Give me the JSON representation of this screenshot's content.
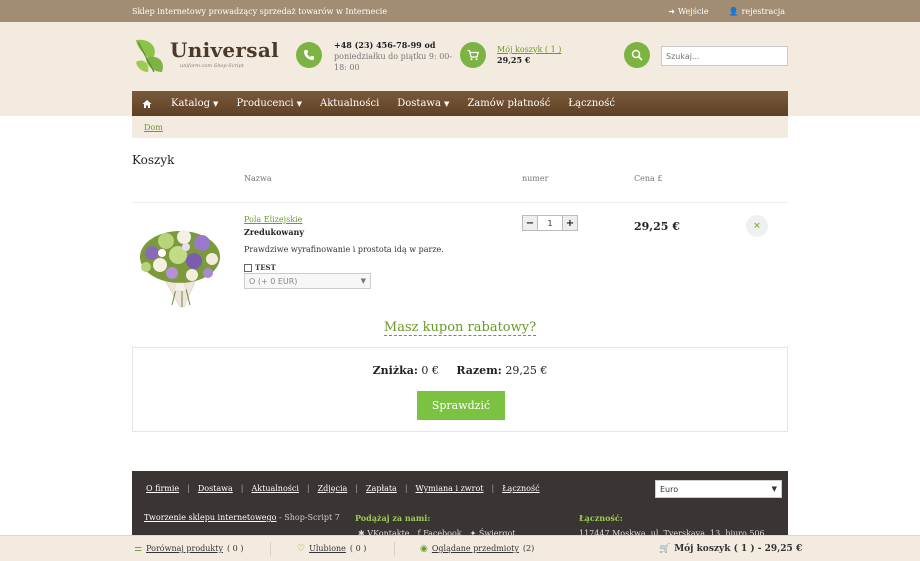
{
  "topbar": {
    "tagline": "Sklep internetowy prowadzący sprzedaż towarów w Internecie",
    "login": "Wejście",
    "register": "rejestracja"
  },
  "logo": {
    "name": "Universal",
    "tagline": "uniform.com Shop-Script"
  },
  "contact": {
    "phone": "+48 (23) 456-78-99 od",
    "hours": "poniedziałku do piątku 9: 00-18: 00"
  },
  "cart": {
    "link": "Mój koszyk ( 1 )",
    "amount": "29,25 €"
  },
  "search": {
    "placeholder": "Szukaj..."
  },
  "nav": {
    "items": [
      {
        "label": "Katalog",
        "dropdown": true
      },
      {
        "label": "Producenci",
        "dropdown": true
      },
      {
        "label": "Aktualności",
        "dropdown": false
      },
      {
        "label": "Dostawa",
        "dropdown": true
      },
      {
        "label": "Zamów płatność",
        "dropdown": false
      },
      {
        "label": "Łączność",
        "dropdown": false
      }
    ]
  },
  "breadcrumb": {
    "home": "Dom"
  },
  "page": {
    "title": "Koszyk",
    "col_name": "Nazwa",
    "col_qty": "numer",
    "col_price": "Cena £"
  },
  "item": {
    "name": "Pola Elizejskie",
    "subtitle": "Zredukowany",
    "description": "Prawdziwe wyrafinowanie i prostota idą w parze.",
    "option_label": "TEST",
    "option_select": "O (+ 0 EUR)",
    "quantity": "1",
    "price": "29,25 €",
    "minus": "−",
    "plus": "+",
    "remove": "×"
  },
  "coupon": {
    "label": "Masz kupon rabatowy?"
  },
  "summary": {
    "discount_label": "Zniżka:",
    "discount_value": "0 €",
    "total_label": "Razem:",
    "total_value": "29,25 €",
    "check_button": "Sprawdzić"
  },
  "footer": {
    "links": [
      "O firmie",
      "Dostawa",
      "Aktualności",
      "Zdjęcia",
      "Zapłata",
      "Wymiana i zwrot",
      "Łączność"
    ],
    "currency": "Euro",
    "made_link": "Tworzenie sklepu internetowego",
    "made_suffix": "- Shop-Script 7",
    "join_label": "Podążaj za nami:",
    "social": [
      "VKontakte",
      "Facebook",
      "Świergot"
    ],
    "contact_label": "Łączność:",
    "address": "117447 Moskwa, ul. Tverskaya, 13, biuro 506"
  },
  "bottombar": {
    "compare": "Porównaj produkty",
    "compare_count": "( 0 )",
    "favorites": "Ulubione",
    "favorites_count": "( 0 )",
    "viewed": "Oglądane przedmioty",
    "viewed_count": "(2)",
    "mycart": "Mój koszyk ( 1 ) - 29,25 €"
  },
  "colors": {
    "accent_green": "#7cb342",
    "nav_brown": "#6b4a2e",
    "header_beige": "#f3ebe0",
    "footer_dark": "#3a3432"
  }
}
